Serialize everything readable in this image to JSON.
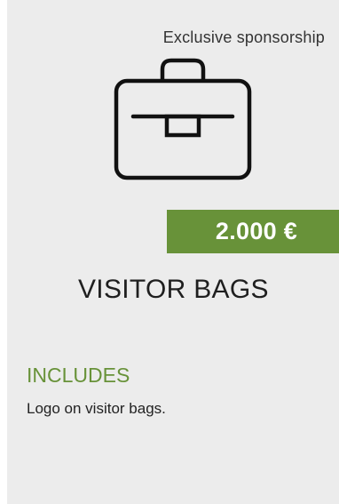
{
  "card": {
    "tag": "Exclusive sponsorship",
    "icon": "briefcase-icon",
    "price": "2.000 €",
    "title": "VISITOR BAGS",
    "includes_label": "INCLUDES",
    "includes_text": "Logo on visitor bags."
  },
  "colors": {
    "accent": "#689239",
    "card_background": "#ececec"
  }
}
